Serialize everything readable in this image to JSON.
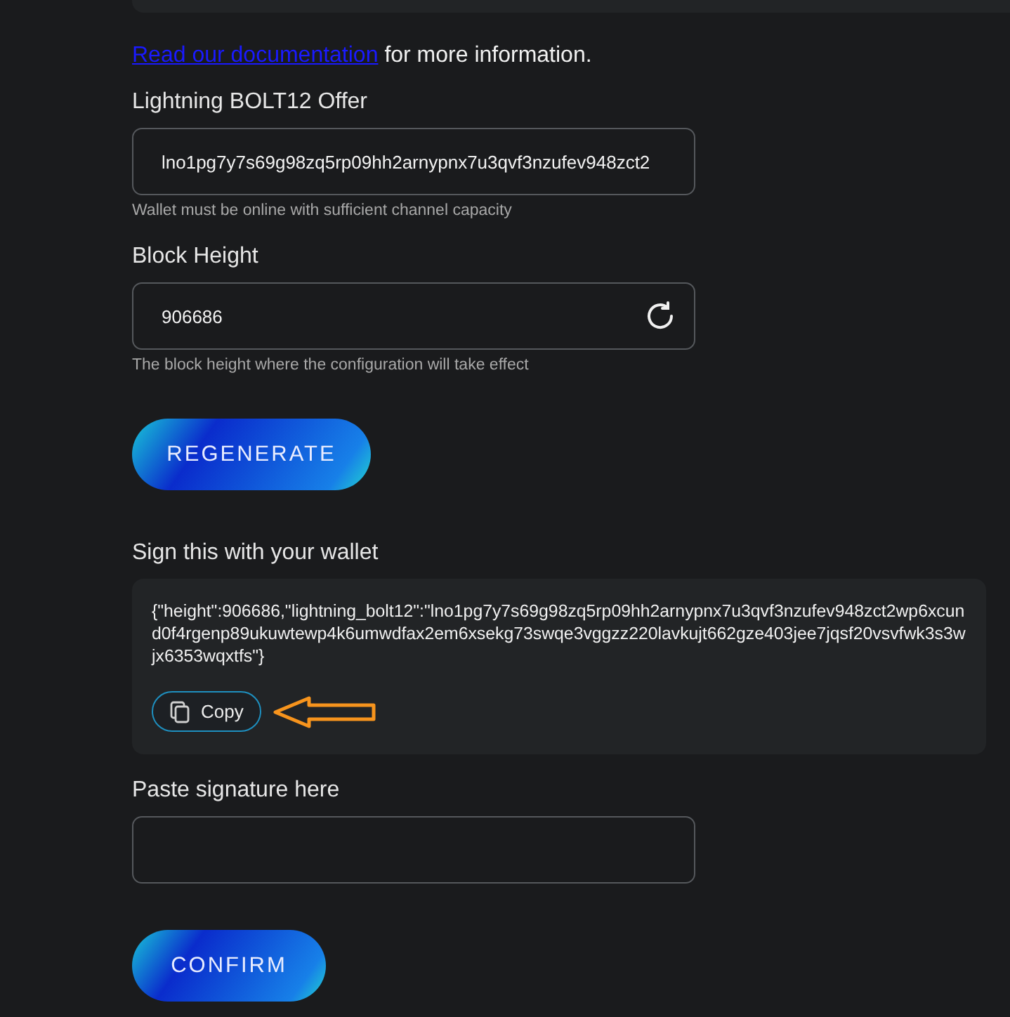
{
  "doc_note": {
    "link": "Read our documentation",
    "text": "for more information."
  },
  "offer": {
    "label": "Lightning BOLT12 Offer",
    "value": "lno1pg7y7s69g98zq5rp09hh2arnypnx7u3qvf3nzufev948zct2",
    "hint": "Wallet must be online with sufficient channel capacity"
  },
  "block_height": {
    "label": "Block Height",
    "value": "906686",
    "hint": "The block height where the configuration will take effect"
  },
  "regenerate_button": "REGENERATE",
  "sign": {
    "label": "Sign this with your wallet",
    "message": "{\"height\":906686,\"lightning_bolt12\":\"lno1pg7y7s69g98zq5rp09hh2arnypnx7u3qvf3nzufev948zct2wp6xcund0f4rgenp89ukuwtewp4k6umwdfax2em6xsekg73swqe3vggzz220lavkujt662gze403jee7jqsf20vsvfwk3s3wjx6353wqxtfs\"}",
    "copy_button": "Copy"
  },
  "signature": {
    "label": "Paste signature here"
  },
  "confirm_button": "CONFIRM"
}
